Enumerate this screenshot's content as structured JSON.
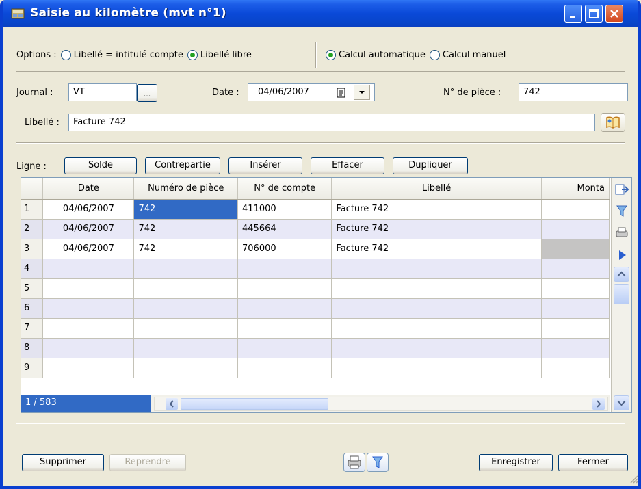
{
  "window": {
    "title": "Saisie au kilomètre (mvt n°1)"
  },
  "options": {
    "label": "Options :",
    "radio1": "Libellé = intitulé compte",
    "radio2": "Libellé libre",
    "radio3": "Calcul automatique",
    "radio4": "Calcul manuel"
  },
  "form": {
    "journal_label": "Journal :",
    "journal_value": "VT",
    "journal_browse": "...",
    "date_label": "Date :",
    "date_value": "04/06/2007",
    "piece_label": "N° de pièce :",
    "piece_value": "742",
    "libelle_label": "Libellé :",
    "libelle_value": "Facture 742"
  },
  "ligne": {
    "label": "Ligne :",
    "solde": "Solde",
    "contrepartie": "Contrepartie",
    "inserer": "Insérer",
    "effacer": "Effacer",
    "dupliquer": "Dupliquer"
  },
  "grid": {
    "headers": [
      "",
      "Date",
      "Numéro de pièce",
      "N° de compte",
      "Libellé",
      "Monta"
    ],
    "rows": [
      [
        "1",
        "04/06/2007",
        "742",
        "411000",
        "Facture 742",
        ""
      ],
      [
        "2",
        "04/06/2007",
        "742",
        "445664",
        "Facture 742",
        ""
      ],
      [
        "3",
        "04/06/2007",
        "742",
        "706000",
        "Facture 742",
        ""
      ],
      [
        "4",
        "",
        "",
        "",
        "",
        ""
      ],
      [
        "5",
        "",
        "",
        "",
        "",
        ""
      ],
      [
        "6",
        "",
        "",
        "",
        "",
        ""
      ],
      [
        "7",
        "",
        "",
        "",
        "",
        ""
      ],
      [
        "8",
        "",
        "",
        "",
        "",
        ""
      ],
      [
        "9",
        "",
        "",
        "",
        "",
        ""
      ]
    ],
    "counter": "1 / 583"
  },
  "footer": {
    "supprimer": "Supprimer",
    "reprendre": "Reprendre",
    "enregistrer": "Enregistrer",
    "fermer": "Fermer"
  }
}
